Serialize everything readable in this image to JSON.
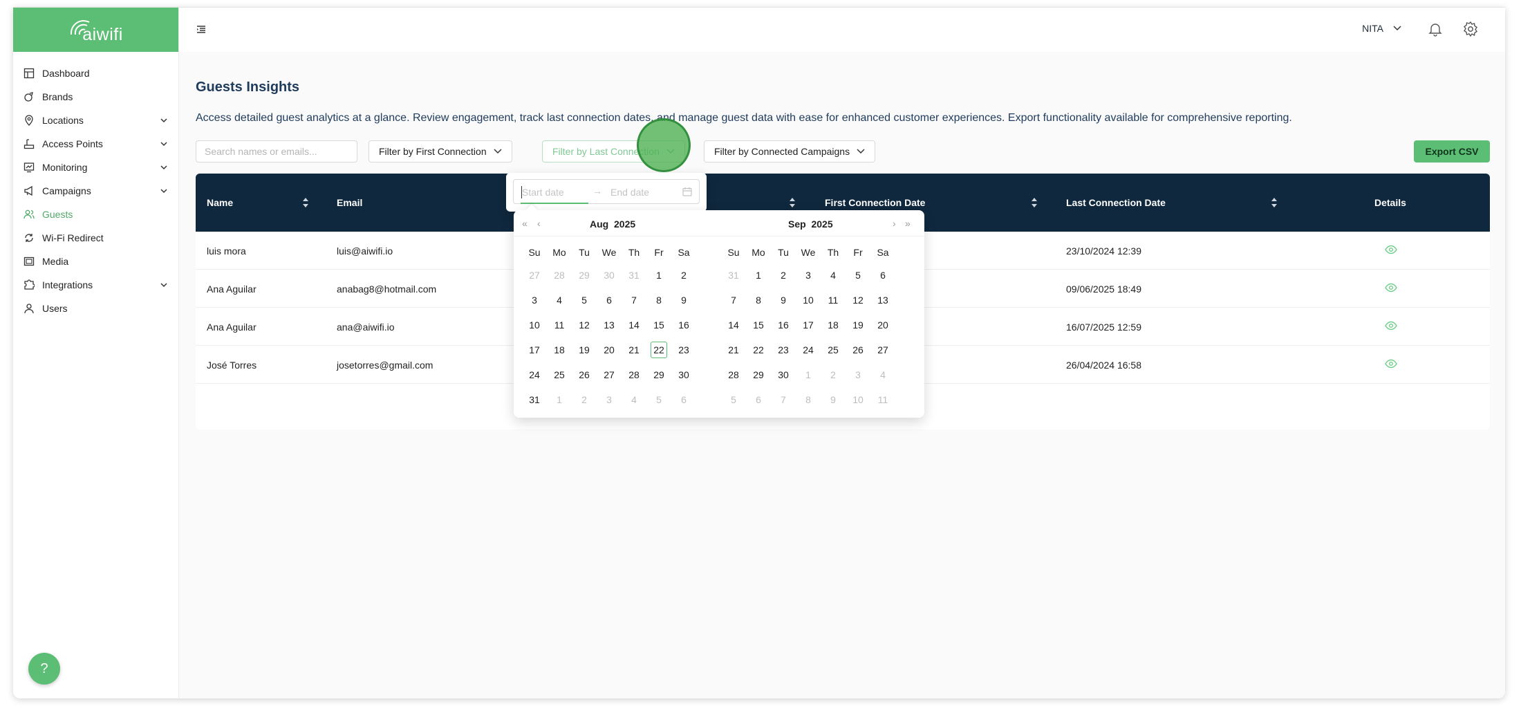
{
  "app": {
    "logo_text": "aiwifi",
    "brand_color": "#5cbd74",
    "header_color": "#10283d"
  },
  "sidebar": {
    "items": [
      {
        "label": "Dashboard",
        "icon": "dashboard-icon",
        "expandable": false
      },
      {
        "label": "Brands",
        "icon": "brand-icon",
        "expandable": false
      },
      {
        "label": "Locations",
        "icon": "location-pin-icon",
        "expandable": true
      },
      {
        "label": "Access Points",
        "icon": "router-icon",
        "expandable": true
      },
      {
        "label": "Monitoring",
        "icon": "monitor-icon",
        "expandable": true
      },
      {
        "label": "Campaigns",
        "icon": "megaphone-icon",
        "expandable": true
      },
      {
        "label": "Guests",
        "icon": "users-icon",
        "expandable": false,
        "active": true
      },
      {
        "label": "Wi-Fi Redirect",
        "icon": "redirect-icon",
        "expandable": false
      },
      {
        "label": "Media",
        "icon": "image-icon",
        "expandable": false
      },
      {
        "label": "Integrations",
        "icon": "puzzle-icon",
        "expandable": true
      },
      {
        "label": "Users",
        "icon": "user-icon",
        "expandable": false
      }
    ],
    "help_label": "?"
  },
  "topbar": {
    "user_name": "NITA"
  },
  "main": {
    "title": "Guests Insights",
    "description": "Access detailed guest analytics at a glance. Review engagement, track last connection dates, and manage guest data with ease for enhanced customer experiences. Export functionality available for comprehensive reporting.",
    "search_placeholder": "Search names or emails...",
    "filter_first": "Filter by First Connection",
    "filter_last": "Filter by Last Connection",
    "filter_campaigns": "Filter by Connected Campaigns",
    "export_label": "Export CSV"
  },
  "table": {
    "headers": {
      "name": "Name",
      "email": "Email",
      "first": "First Connection Date",
      "last": "Last Connection Date",
      "details": "Details"
    },
    "rows": [
      {
        "name": "luis mora",
        "email": "luis@aiwifi.io",
        "last": "23/10/2024 12:39"
      },
      {
        "name": "Ana Aguilar",
        "email": "anabag8@hotmail.com",
        "last": "09/06/2025 18:49"
      },
      {
        "name": "Ana Aguilar",
        "email": "ana@aiwifi.io",
        "last": "16/07/2025 12:59"
      },
      {
        "name": "José Torres",
        "email": "josetorres@gmail.com",
        "last": "26/04/2024 16:58"
      }
    ]
  },
  "datepicker": {
    "start_placeholder": "Start date",
    "end_placeholder": "End date",
    "separator": "→",
    "weekdays": [
      "Su",
      "Mo",
      "Tu",
      "We",
      "Th",
      "Fr",
      "Sa"
    ],
    "left": {
      "month": "Aug",
      "year": "2025",
      "days": [
        "27",
        "28",
        "29",
        "30",
        "31",
        "1",
        "2",
        "3",
        "4",
        "5",
        "6",
        "7",
        "8",
        "9",
        "10",
        "11",
        "12",
        "13",
        "14",
        "15",
        "16",
        "17",
        "18",
        "19",
        "20",
        "21",
        "22",
        "23",
        "24",
        "25",
        "26",
        "27",
        "28",
        "29",
        "30",
        "31",
        "1",
        "2",
        "3",
        "4",
        "5",
        "6"
      ],
      "muted": [
        0,
        1,
        2,
        3,
        4,
        36,
        37,
        38,
        39,
        40,
        41
      ],
      "today": 26
    },
    "right": {
      "month": "Sep",
      "year": "2025",
      "days": [
        "31",
        "1",
        "2",
        "3",
        "4",
        "5",
        "6",
        "7",
        "8",
        "9",
        "10",
        "11",
        "12",
        "13",
        "14",
        "15",
        "16",
        "17",
        "18",
        "19",
        "20",
        "21",
        "22",
        "23",
        "24",
        "25",
        "26",
        "27",
        "28",
        "29",
        "30",
        "1",
        "2",
        "3",
        "4",
        "5",
        "6",
        "7",
        "8",
        "9",
        "10",
        "11"
      ],
      "muted": [
        0,
        31,
        32,
        33,
        34,
        35,
        36,
        37,
        38,
        39,
        40,
        41
      ],
      "today": -1
    }
  }
}
